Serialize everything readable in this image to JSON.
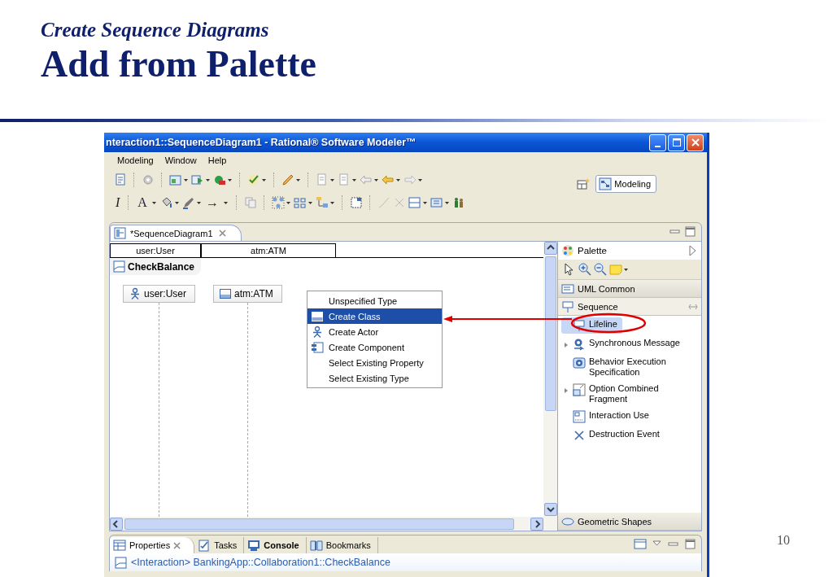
{
  "slide": {
    "subtitle": "Create Sequence Diagrams",
    "title": "Add from Palette",
    "page_number": "10"
  },
  "window": {
    "title": "nteraction1::SequenceDiagram1 - Rational® Software Modeler™"
  },
  "menu": [
    "Modeling",
    "Window",
    "Help"
  ],
  "format_toolbar_labels": [
    "I",
    "A",
    "→"
  ],
  "perspective": {
    "label": "Modeling"
  },
  "editor_tab": {
    "label": "*SequenceDiagram1"
  },
  "diagram": {
    "header_cells": [
      "user:User",
      "atm:ATM"
    ],
    "frame_label": "CheckBalance",
    "lifelines": [
      {
        "kind": "actor",
        "label": "user:User"
      },
      {
        "kind": "class",
        "label": "atm:ATM"
      }
    ]
  },
  "popup_menu": [
    {
      "kind": "plain",
      "label": "Unspecified Type",
      "selected": false
    },
    {
      "kind": "class",
      "label": "Create Class",
      "selected": true
    },
    {
      "kind": "actor",
      "label": "Create Actor",
      "selected": false
    },
    {
      "kind": "component",
      "label": "Create Component",
      "selected": false
    },
    {
      "kind": "plain",
      "label": "Select Existing Property",
      "selected": false
    },
    {
      "kind": "plain",
      "label": "Select Existing Type",
      "selected": false
    }
  ],
  "palette": {
    "title": "Palette",
    "drawers": [
      {
        "kind": "common",
        "label": "UML Common",
        "expanded": false
      },
      {
        "kind": "sequence",
        "label": "Sequence",
        "expanded": true,
        "items": [
          {
            "kind": "lifeline",
            "label": "Lifeline",
            "selected": true,
            "has_submenu": false
          },
          {
            "kind": "message",
            "label": "Synchronous Message",
            "selected": false,
            "has_submenu": true
          },
          {
            "kind": "execution",
            "label": "Behavior Execution Specification",
            "selected": false,
            "has_submenu": false
          },
          {
            "kind": "fragment",
            "label": "Option Combined Fragment",
            "selected": false,
            "has_submenu": true
          },
          {
            "kind": "interaction_use",
            "label": "Interaction Use",
            "selected": false,
            "has_submenu": false
          },
          {
            "kind": "destruction",
            "label": "Destruction Event",
            "selected": false,
            "has_submenu": false
          }
        ]
      },
      {
        "kind": "shapes",
        "label": "Geometric Shapes",
        "expanded": false
      }
    ]
  },
  "bottom_panel": {
    "tabs": [
      {
        "kind": "properties",
        "label": "Properties",
        "selected": true,
        "closable": true,
        "emphasized": false
      },
      {
        "kind": "tasks",
        "label": "Tasks",
        "selected": false,
        "closable": false,
        "emphasized": false
      },
      {
        "kind": "console",
        "label": "Console",
        "selected": false,
        "closable": false,
        "emphasized": true
      },
      {
        "kind": "bookmarks",
        "label": "Bookmarks",
        "selected": false,
        "closable": false,
        "emphasized": false
      }
    ],
    "header": "<Interaction> BankingApp::Collaboration1::CheckBalance"
  }
}
